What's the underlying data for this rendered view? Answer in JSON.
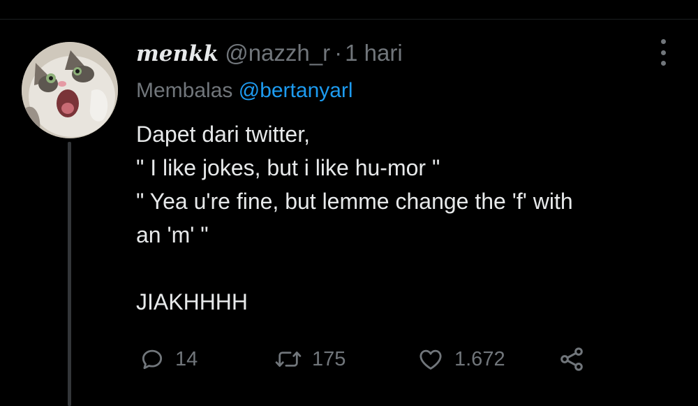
{
  "tweet": {
    "author": {
      "display_name": "menkk",
      "handle": "@nazzh_r",
      "separator": "·",
      "time": "1 hari",
      "avatar_icon": "cat-avatar"
    },
    "reply_to": {
      "prefix": "Membalas",
      "handle": "@bertanyarl"
    },
    "text_lines": [
      "Dapet dari twitter,",
      "\" I like jokes, but i like hu-mor \"",
      "\" Yea u're fine, but lemme change the 'f' with",
      "an 'm' \"",
      "",
      "JIAKHHHH"
    ],
    "metrics": {
      "replies": "14",
      "retweets": "175",
      "likes": "1.672"
    }
  },
  "colors": {
    "background": "#000000",
    "text_primary": "#e7e9ea",
    "text_secondary": "#71767b",
    "link": "#1d9bf0"
  },
  "icons": {
    "reply": "reply-icon",
    "retweet": "retweet-icon",
    "like": "heart-icon",
    "share": "share-icon",
    "more": "more-options-icon"
  }
}
